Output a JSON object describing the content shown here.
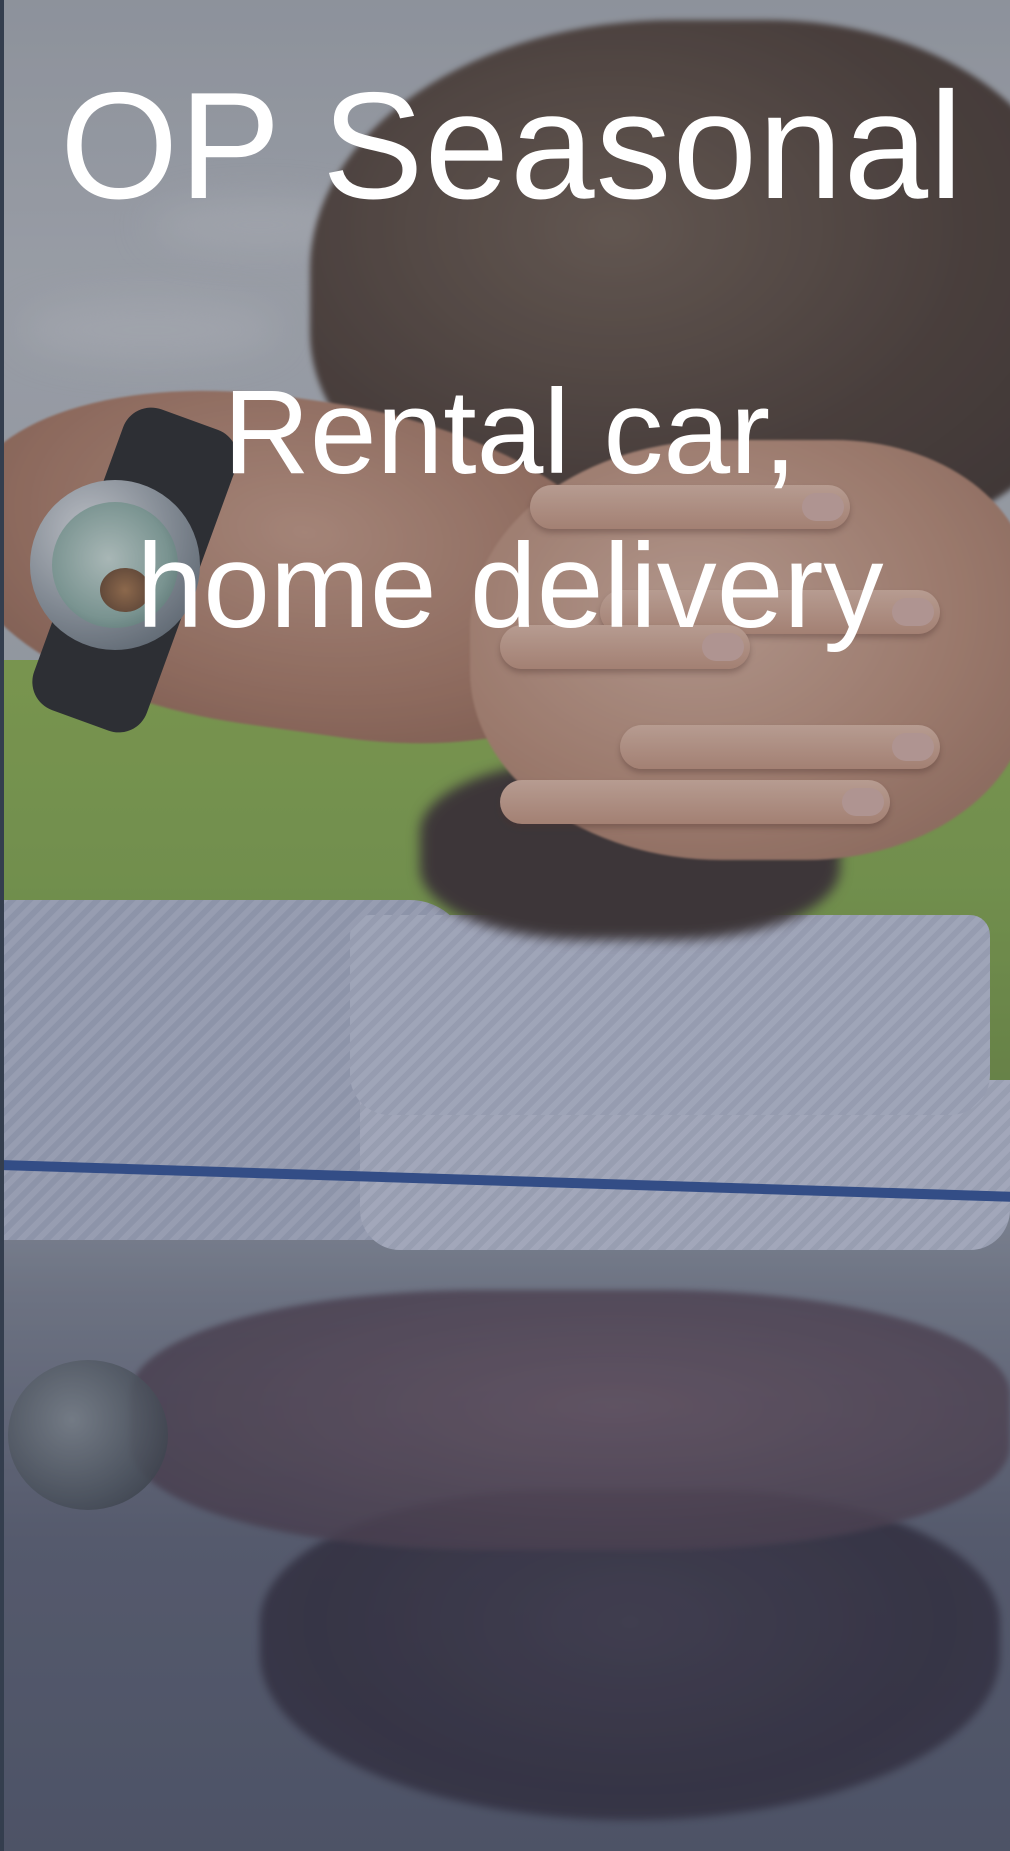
{
  "hero": {
    "title": "OP Seasonal",
    "subtitle": "Rental car, home delivery",
    "image": "man-relaxing-on-car-roof-photo",
    "text_color": "#ffffff",
    "overlay_color": "#464a5e"
  }
}
